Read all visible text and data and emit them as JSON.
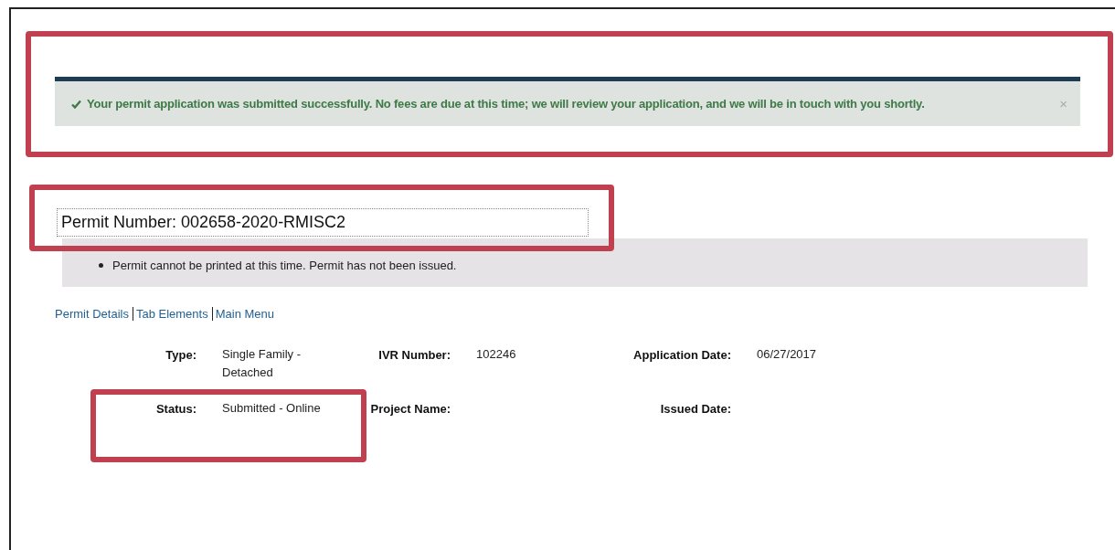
{
  "banner": {
    "message": "Your permit application was submitted successfully. No fees are due at this time; we will review your application, and we will be in touch with you shortly.",
    "close": "×",
    "highlighted": true
  },
  "permit": {
    "heading": "Permit Number: 002658-2020-RMISC2",
    "highlighted": true
  },
  "notices": [
    "Permit cannot be printed at this time. Permit has not been issued."
  ],
  "links": [
    "Permit Details",
    "Tab Elements",
    "Main Menu"
  ],
  "details": [
    [
      {
        "label": "Type:",
        "value": "Single Family - Detached",
        "highlighted": false
      },
      {
        "label": "IVR Number:",
        "value": "102246",
        "highlighted": false
      },
      {
        "label": "Application Date:",
        "value": "06/27/2017",
        "highlighted": false
      }
    ],
    [
      {
        "label": "Status:",
        "value": "Submitted - Online",
        "highlighted": true
      },
      {
        "label": "Project Name:",
        "highlighted": false
      },
      {
        "label": "Issued Date:",
        "highlighted": false
      }
    ]
  ]
}
